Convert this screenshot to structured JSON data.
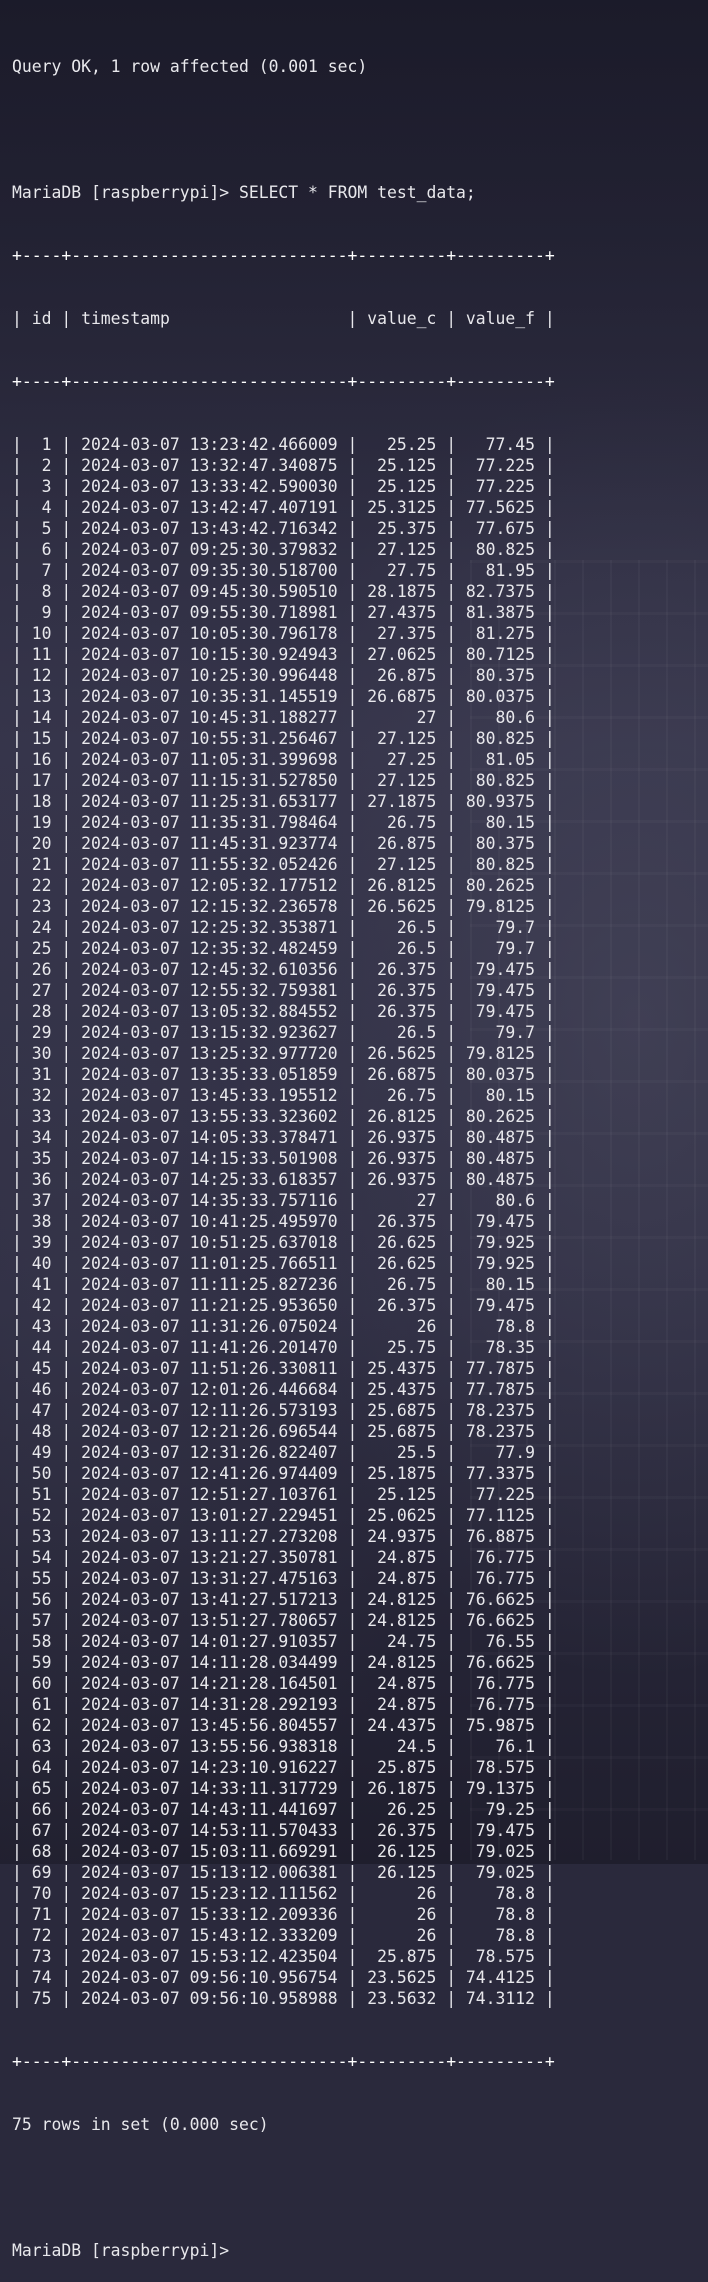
{
  "terminal": {
    "query_ok": "Query OK, 1 row affected (0.001 sec)",
    "prompt_command": "MariaDB [raspberrypi]> SELECT * FROM test_data;",
    "border": "+----+----------------------------+---------+---------+",
    "header_row": "| id | timestamp                  | value_c | value_f |",
    "columns": [
      "id",
      "timestamp",
      "value_c",
      "value_f"
    ],
    "rows": [
      [
        "1",
        "2024-03-07 13:23:42.466009",
        "25.25",
        "77.45"
      ],
      [
        "2",
        "2024-03-07 13:32:47.340875",
        "25.125",
        "77.225"
      ],
      [
        "3",
        "2024-03-07 13:33:42.590030",
        "25.125",
        "77.225"
      ],
      [
        "4",
        "2024-03-07 13:42:47.407191",
        "25.3125",
        "77.5625"
      ],
      [
        "5",
        "2024-03-07 13:43:42.716342",
        "25.375",
        "77.675"
      ],
      [
        "6",
        "2024-03-07 09:25:30.379832",
        "27.125",
        "80.825"
      ],
      [
        "7",
        "2024-03-07 09:35:30.518700",
        "27.75",
        "81.95"
      ],
      [
        "8",
        "2024-03-07 09:45:30.590510",
        "28.1875",
        "82.7375"
      ],
      [
        "9",
        "2024-03-07 09:55:30.718981",
        "27.4375",
        "81.3875"
      ],
      [
        "10",
        "2024-03-07 10:05:30.796178",
        "27.375",
        "81.275"
      ],
      [
        "11",
        "2024-03-07 10:15:30.924943",
        "27.0625",
        "80.7125"
      ],
      [
        "12",
        "2024-03-07 10:25:30.996448",
        "26.875",
        "80.375"
      ],
      [
        "13",
        "2024-03-07 10:35:31.145519",
        "26.6875",
        "80.0375"
      ],
      [
        "14",
        "2024-03-07 10:45:31.188277",
        "27",
        "80.6"
      ],
      [
        "15",
        "2024-03-07 10:55:31.256467",
        "27.125",
        "80.825"
      ],
      [
        "16",
        "2024-03-07 11:05:31.399698",
        "27.25",
        "81.05"
      ],
      [
        "17",
        "2024-03-07 11:15:31.527850",
        "27.125",
        "80.825"
      ],
      [
        "18",
        "2024-03-07 11:25:31.653177",
        "27.1875",
        "80.9375"
      ],
      [
        "19",
        "2024-03-07 11:35:31.798464",
        "26.75",
        "80.15"
      ],
      [
        "20",
        "2024-03-07 11:45:31.923774",
        "26.875",
        "80.375"
      ],
      [
        "21",
        "2024-03-07 11:55:32.052426",
        "27.125",
        "80.825"
      ],
      [
        "22",
        "2024-03-07 12:05:32.177512",
        "26.8125",
        "80.2625"
      ],
      [
        "23",
        "2024-03-07 12:15:32.236578",
        "26.5625",
        "79.8125"
      ],
      [
        "24",
        "2024-03-07 12:25:32.353871",
        "26.5",
        "79.7"
      ],
      [
        "25",
        "2024-03-07 12:35:32.482459",
        "26.5",
        "79.7"
      ],
      [
        "26",
        "2024-03-07 12:45:32.610356",
        "26.375",
        "79.475"
      ],
      [
        "27",
        "2024-03-07 12:55:32.759381",
        "26.375",
        "79.475"
      ],
      [
        "28",
        "2024-03-07 13:05:32.884552",
        "26.375",
        "79.475"
      ],
      [
        "29",
        "2024-03-07 13:15:32.923627",
        "26.5",
        "79.7"
      ],
      [
        "30",
        "2024-03-07 13:25:32.977720",
        "26.5625",
        "79.8125"
      ],
      [
        "31",
        "2024-03-07 13:35:33.051859",
        "26.6875",
        "80.0375"
      ],
      [
        "32",
        "2024-03-07 13:45:33.195512",
        "26.75",
        "80.15"
      ],
      [
        "33",
        "2024-03-07 13:55:33.323602",
        "26.8125",
        "80.2625"
      ],
      [
        "34",
        "2024-03-07 14:05:33.378471",
        "26.9375",
        "80.4875"
      ],
      [
        "35",
        "2024-03-07 14:15:33.501908",
        "26.9375",
        "80.4875"
      ],
      [
        "36",
        "2024-03-07 14:25:33.618357",
        "26.9375",
        "80.4875"
      ],
      [
        "37",
        "2024-03-07 14:35:33.757116",
        "27",
        "80.6"
      ],
      [
        "38",
        "2024-03-07 10:41:25.495970",
        "26.375",
        "79.475"
      ],
      [
        "39",
        "2024-03-07 10:51:25.637018",
        "26.625",
        "79.925"
      ],
      [
        "40",
        "2024-03-07 11:01:25.766511",
        "26.625",
        "79.925"
      ],
      [
        "41",
        "2024-03-07 11:11:25.827236",
        "26.75",
        "80.15"
      ],
      [
        "42",
        "2024-03-07 11:21:25.953650",
        "26.375",
        "79.475"
      ],
      [
        "43",
        "2024-03-07 11:31:26.075024",
        "26",
        "78.8"
      ],
      [
        "44",
        "2024-03-07 11:41:26.201470",
        "25.75",
        "78.35"
      ],
      [
        "45",
        "2024-03-07 11:51:26.330811",
        "25.4375",
        "77.7875"
      ],
      [
        "46",
        "2024-03-07 12:01:26.446684",
        "25.4375",
        "77.7875"
      ],
      [
        "47",
        "2024-03-07 12:11:26.573193",
        "25.6875",
        "78.2375"
      ],
      [
        "48",
        "2024-03-07 12:21:26.696544",
        "25.6875",
        "78.2375"
      ],
      [
        "49",
        "2024-03-07 12:31:26.822407",
        "25.5",
        "77.9"
      ],
      [
        "50",
        "2024-03-07 12:41:26.974409",
        "25.1875",
        "77.3375"
      ],
      [
        "51",
        "2024-03-07 12:51:27.103761",
        "25.125",
        "77.225"
      ],
      [
        "52",
        "2024-03-07 13:01:27.229451",
        "25.0625",
        "77.1125"
      ],
      [
        "53",
        "2024-03-07 13:11:27.273208",
        "24.9375",
        "76.8875"
      ],
      [
        "54",
        "2024-03-07 13:21:27.350781",
        "24.875",
        "76.775"
      ],
      [
        "55",
        "2024-03-07 13:31:27.475163",
        "24.875",
        "76.775"
      ],
      [
        "56",
        "2024-03-07 13:41:27.517213",
        "24.8125",
        "76.6625"
      ],
      [
        "57",
        "2024-03-07 13:51:27.780657",
        "24.8125",
        "76.6625"
      ],
      [
        "58",
        "2024-03-07 14:01:27.910357",
        "24.75",
        "76.55"
      ],
      [
        "59",
        "2024-03-07 14:11:28.034499",
        "24.8125",
        "76.6625"
      ],
      [
        "60",
        "2024-03-07 14:21:28.164501",
        "24.875",
        "76.775"
      ],
      [
        "61",
        "2024-03-07 14:31:28.292193",
        "24.875",
        "76.775"
      ],
      [
        "62",
        "2024-03-07 13:45:56.804557",
        "24.4375",
        "75.9875"
      ],
      [
        "63",
        "2024-03-07 13:55:56.938318",
        "24.5",
        "76.1"
      ],
      [
        "64",
        "2024-03-07 14:23:10.916227",
        "25.875",
        "78.575"
      ],
      [
        "65",
        "2024-03-07 14:33:11.317729",
        "26.1875",
        "79.1375"
      ],
      [
        "66",
        "2024-03-07 14:43:11.441697",
        "26.25",
        "79.25"
      ],
      [
        "67",
        "2024-03-07 14:53:11.570433",
        "26.375",
        "79.475"
      ],
      [
        "68",
        "2024-03-07 15:03:11.669291",
        "26.125",
        "79.025"
      ],
      [
        "69",
        "2024-03-07 15:13:12.006381",
        "26.125",
        "79.025"
      ],
      [
        "70",
        "2024-03-07 15:23:12.111562",
        "26",
        "78.8"
      ],
      [
        "71",
        "2024-03-07 15:33:12.209336",
        "26",
        "78.8"
      ],
      [
        "72",
        "2024-03-07 15:43:12.333209",
        "26",
        "78.8"
      ],
      [
        "73",
        "2024-03-07 15:53:12.423504",
        "25.875",
        "78.575"
      ],
      [
        "74",
        "2024-03-07 09:56:10.956754",
        "23.5625",
        "74.4125"
      ],
      [
        "75",
        "2024-03-07 09:56:10.958988",
        "23.5632",
        "74.3112"
      ]
    ],
    "rows_in_set": "75 rows in set (0.000 sec)",
    "final_prompt": "MariaDB [raspberrypi]>"
  }
}
